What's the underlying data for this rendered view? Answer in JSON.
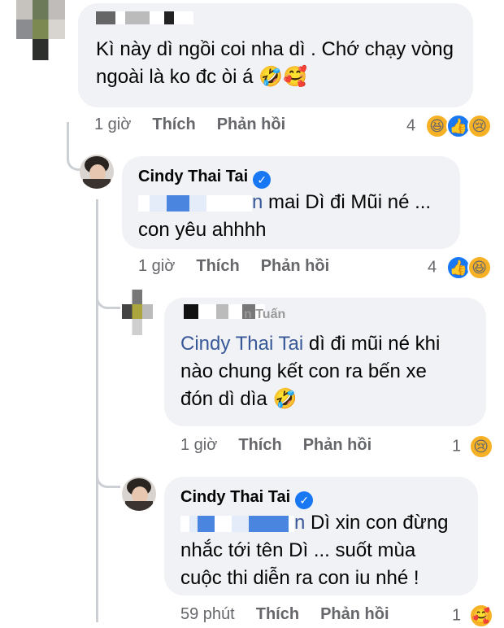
{
  "comments": [
    {
      "author": "",
      "text": "Kì này dì ngồi coi nha dì . Chớ chạy vòng ngoài là ko đc òi á",
      "emojis": "🤣🥰",
      "time": "1 giờ",
      "like": "Thích",
      "reply": "Phản hồi",
      "reaction_count": "4",
      "reactions": [
        "😆",
        "👍",
        "😢"
      ]
    },
    {
      "author": "Cindy Thai Tai",
      "verified": "✓",
      "mention_tail": "n",
      "text": "mai Dì đi Mũi né ... con yêu ahhhh",
      "time": "1 giờ",
      "like": "Thích",
      "reply": "Phản hồi",
      "reaction_count": "4",
      "reactions": [
        "👍",
        "😆"
      ]
    },
    {
      "author_tail": "n Tuấn",
      "mention": "Cindy Thai Tai",
      "text_line1": " dì đi mũi né khi",
      "text_line2": "nào chung kết  con ra bến xe",
      "text_line3": "đón dì dìa",
      "emojis": "🤣",
      "time": "1 giờ",
      "like": "Thích",
      "reply": "Phản hồi",
      "reaction_count": "1",
      "reactions": [
        "😢"
      ]
    },
    {
      "author": "Cindy Thai Tai",
      "verified": "✓",
      "mention_tail": "n",
      "text_line1": "Dì xin con đừng",
      "text_line2": "nhắc tới tên Dì ... suốt mùa",
      "text_line3": "cuộc thi diễn ra con iu nhé !",
      "time": "59 phút",
      "like": "Thích",
      "reply": "Phản hồi",
      "reaction_count": "1",
      "reactions": [
        "🥰"
      ]
    }
  ],
  "colors": {
    "bubble": "#f0f2f5",
    "meta": "#65676b",
    "link": "#385898",
    "verified": "#1877f2"
  }
}
